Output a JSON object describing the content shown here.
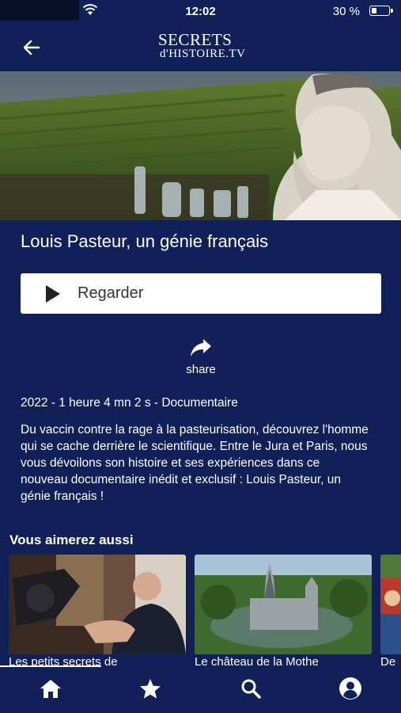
{
  "status_bar": {
    "time": "12:02",
    "battery": "30 %"
  },
  "header": {
    "logo_line1": "SECRETS",
    "logo_line2": "d'HISTOIRE.TV"
  },
  "program": {
    "title": "Louis Pasteur, un génie français",
    "watch_label": "Regarder",
    "share_label": "share",
    "meta": "2022 - 1 heure 4 mn 2 s  - Documentaire",
    "description": "Du vaccin contre la rage à la pasteurisation, découvrez l'homme qui se cache derrière le scientifique. Entre le Jura et Paris, nous vous dévoilons son histoire et ses expériences dans ce nouveau documentaire inédit et exclusif : Louis Pasteur, un génie français !"
  },
  "recommendations": {
    "title": "Vous aimerez aussi",
    "items": [
      {
        "caption": "Les petits secrets de"
      },
      {
        "caption": "Le château de la Mothe"
      },
      {
        "caption": "De"
      }
    ]
  },
  "tabs": [
    {
      "icon": "home-icon"
    },
    {
      "icon": "star-icon"
    },
    {
      "icon": "search-icon"
    },
    {
      "icon": "account-icon"
    }
  ],
  "colors": {
    "background": "#12205a",
    "button": "#ffffff"
  }
}
